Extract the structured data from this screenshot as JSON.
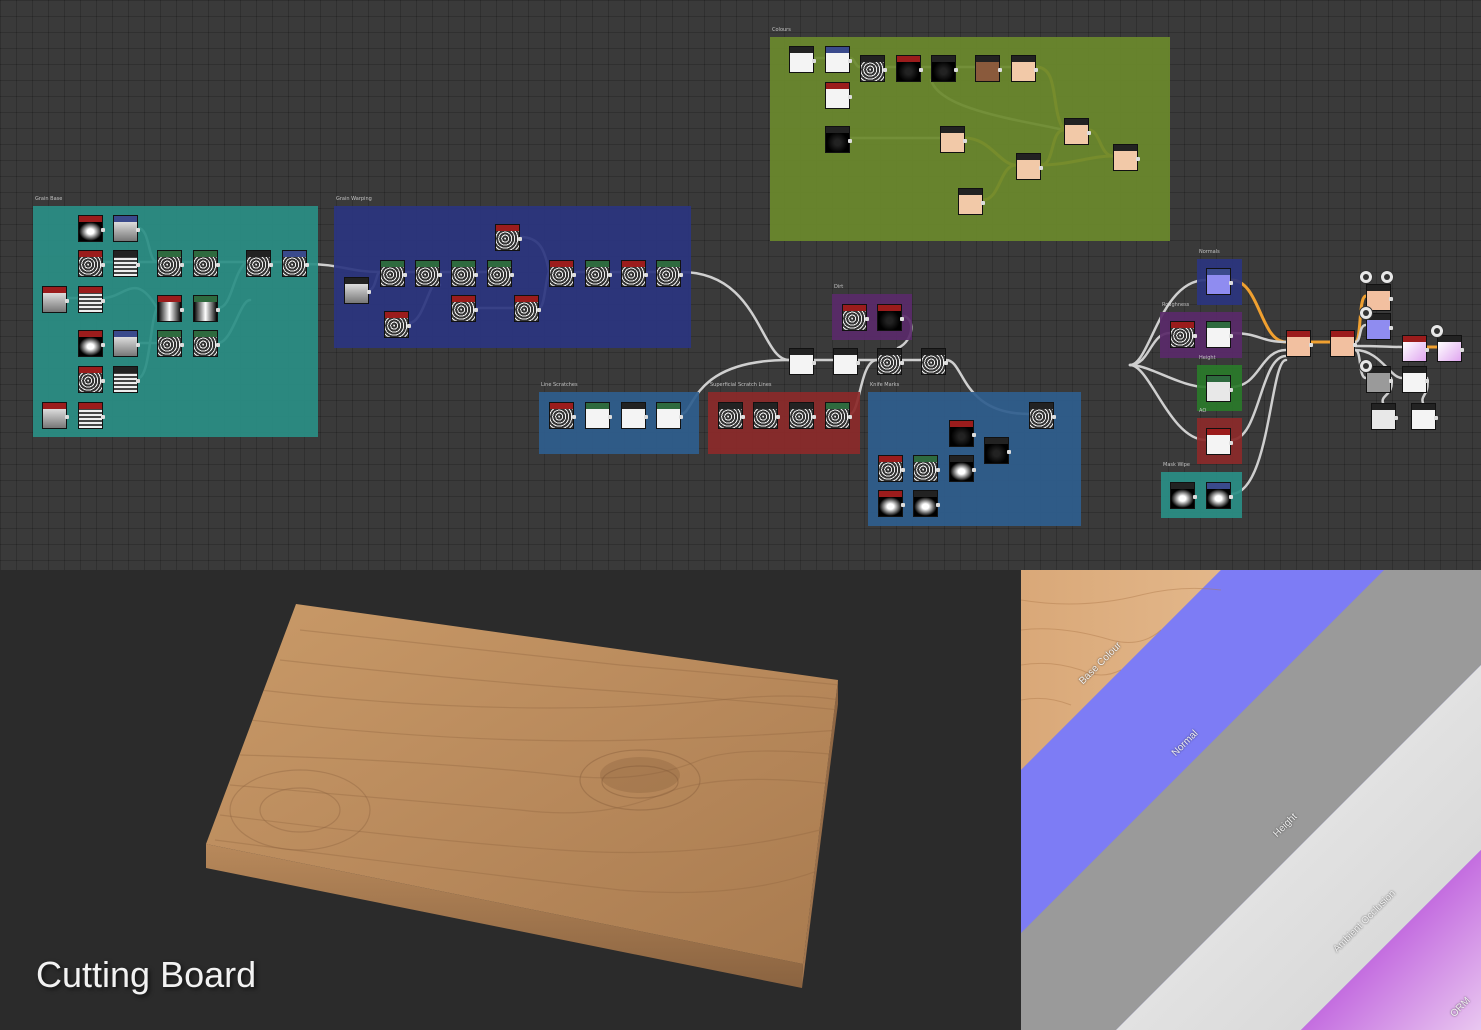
{
  "title": "Cutting Board",
  "graph": {
    "frames": [
      {
        "title": "Grain Base",
        "color": "#2a8f86"
      },
      {
        "title": "Grain Warping",
        "color": "#2b3580"
      },
      {
        "title": "Colours",
        "color": "#6b8a2d"
      },
      {
        "title": "Dirt",
        "color": "#5a2a6a"
      },
      {
        "title": "Line Scratches",
        "color": "#2f5e8e"
      },
      {
        "title": "Superficial Scratch Lines",
        "color": "#8c2a2a"
      },
      {
        "title": "Knife Marks",
        "color": "#2f5e8e"
      },
      {
        "title": "Normals",
        "color": "#2b3580"
      },
      {
        "title": "Roughness",
        "color": "#5a2a6a"
      },
      {
        "title": "Height",
        "color": "#2a7a2a"
      },
      {
        "title": "AO",
        "color": "#8c2a2a"
      },
      {
        "title": "Mask Wipe",
        "color": "#2a8f86"
      }
    ]
  },
  "maps": {
    "labels": [
      "Base Colour",
      "Normal",
      "Height",
      "Ambient Occlusion",
      "ORM"
    ],
    "colors": {
      "base_colour": "#d8a576",
      "normal": "#7d7cf5",
      "height": "#9a9a9a",
      "ao": "#e2e2e2",
      "orm": "#c77de0"
    }
  },
  "colors": {
    "graph_bg": "#3a3a3a",
    "wire": "#cfcfcf",
    "wire_color_link": "#f0a030",
    "node_header_red": "#9b1c1c",
    "node_header_blue": "#3a4a8c",
    "node_header_green": "#2e6a3e"
  }
}
